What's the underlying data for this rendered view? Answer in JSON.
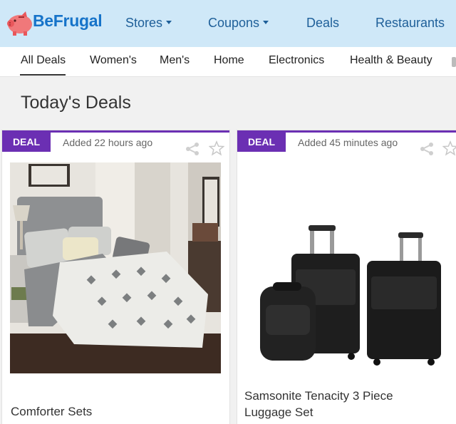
{
  "brand": {
    "name": "BeFrugal"
  },
  "nav": {
    "items": [
      {
        "label": "Stores",
        "has_dropdown": true
      },
      {
        "label": "Coupons",
        "has_dropdown": true
      },
      {
        "label": "Deals",
        "has_dropdown": false
      },
      {
        "label": "Restaurants",
        "has_dropdown": false
      }
    ]
  },
  "categories": [
    "All Deals",
    "Women's",
    "Men's",
    "Home",
    "Electronics",
    "Health & Beauty"
  ],
  "active_category": "All Deals",
  "page": {
    "title": "Today's Deals"
  },
  "deals": [
    {
      "badge": "DEAL",
      "added": "Added 22 hours ago",
      "title": "Comforter Sets"
    },
    {
      "badge": "DEAL",
      "added": "Added 45 minutes ago",
      "title": "Samsonite Tenacity 3 Piece Luggage Set"
    }
  ],
  "colors": {
    "accent": "#6b2fb3",
    "topbar": "#cfe8f8",
    "nav_text": "#1e5f99",
    "logo_blue": "#1673c9",
    "pig_pink": "#f0787a"
  }
}
